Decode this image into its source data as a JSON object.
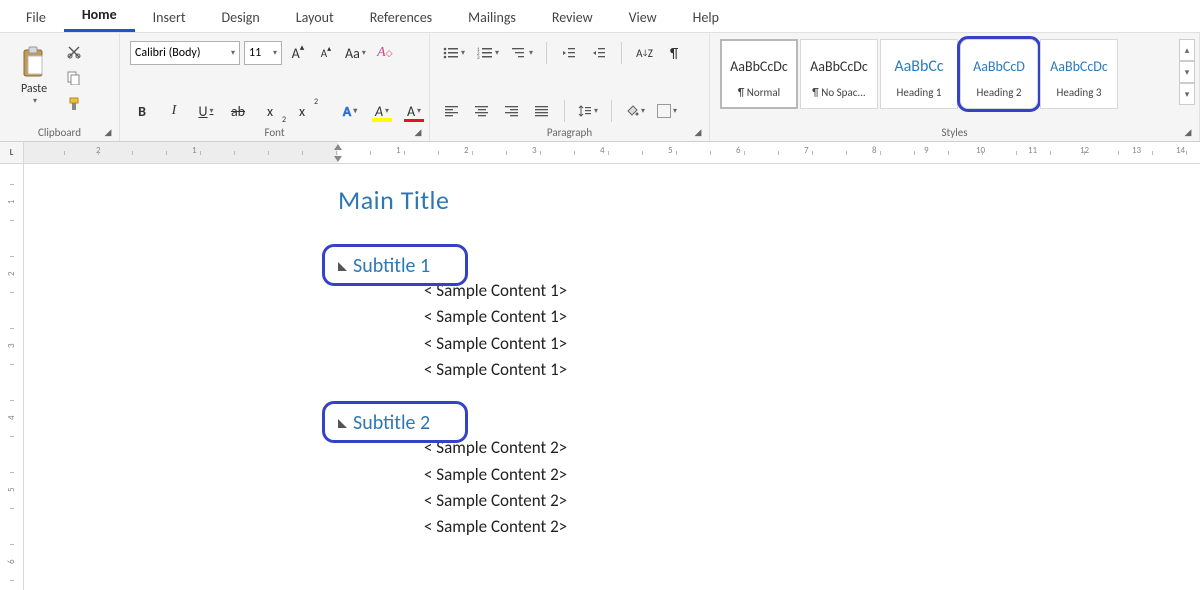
{
  "tabs": {
    "file": "File",
    "home": "Home",
    "insert": "Insert",
    "design": "Design",
    "layout": "Layout",
    "references": "References",
    "mailings": "Mailings",
    "review": "Review",
    "view": "View",
    "help": "Help"
  },
  "clipboard": {
    "paste": "Paste",
    "label": "Clipboard"
  },
  "font": {
    "name": "Calibri (Body)",
    "size": "11",
    "case": "Aa",
    "label": "Font",
    "bold": "B",
    "italic": "I",
    "underline": "U",
    "strike": "ab",
    "sub": "x",
    "sup": "x",
    "effects": "A",
    "highlight": "A",
    "color": "A",
    "growA": "A",
    "shrinkA": "A"
  },
  "paragraph": {
    "label": "Paragraph",
    "sort": "A↓Z",
    "pil": "¶"
  },
  "styles": {
    "label": "Styles",
    "items": [
      {
        "preview": "AaBbCcDc",
        "name": "¶ Normal",
        "cls": ""
      },
      {
        "preview": "AaBbCcDc",
        "name": "¶ No Spac...",
        "cls": ""
      },
      {
        "preview": "AaBbCc",
        "name": "Heading 1",
        "cls": "h1p"
      },
      {
        "preview": "AaBbCcD",
        "name": "Heading 2",
        "cls": "h2p",
        "highlight": true
      },
      {
        "preview": "AaBbCcDc",
        "name": "Heading 3",
        "cls": "h2p"
      }
    ]
  },
  "ruler": {
    "h": [
      "2",
      "1",
      "1",
      "2",
      "3",
      "4",
      "5",
      "6",
      "7",
      "8",
      "9",
      "10",
      "11",
      "12",
      "13",
      "14",
      "15"
    ],
    "v": [
      "1",
      "2",
      "3",
      "4",
      "5",
      "6"
    ]
  },
  "doc": {
    "title": "Main Title",
    "sections": [
      {
        "heading": "Subtitle 1",
        "highlight": true,
        "body": [
          "< Sample Content 1>",
          "< Sample Content 1>",
          "< Sample Content 1>",
          "< Sample Content 1>"
        ]
      },
      {
        "heading": "Subtitle 2",
        "highlight": true,
        "body": [
          "< Sample Content 2>",
          "< Sample Content 2>",
          "< Sample Content 2>",
          "< Sample Content 2>"
        ]
      }
    ]
  },
  "corner": "L"
}
